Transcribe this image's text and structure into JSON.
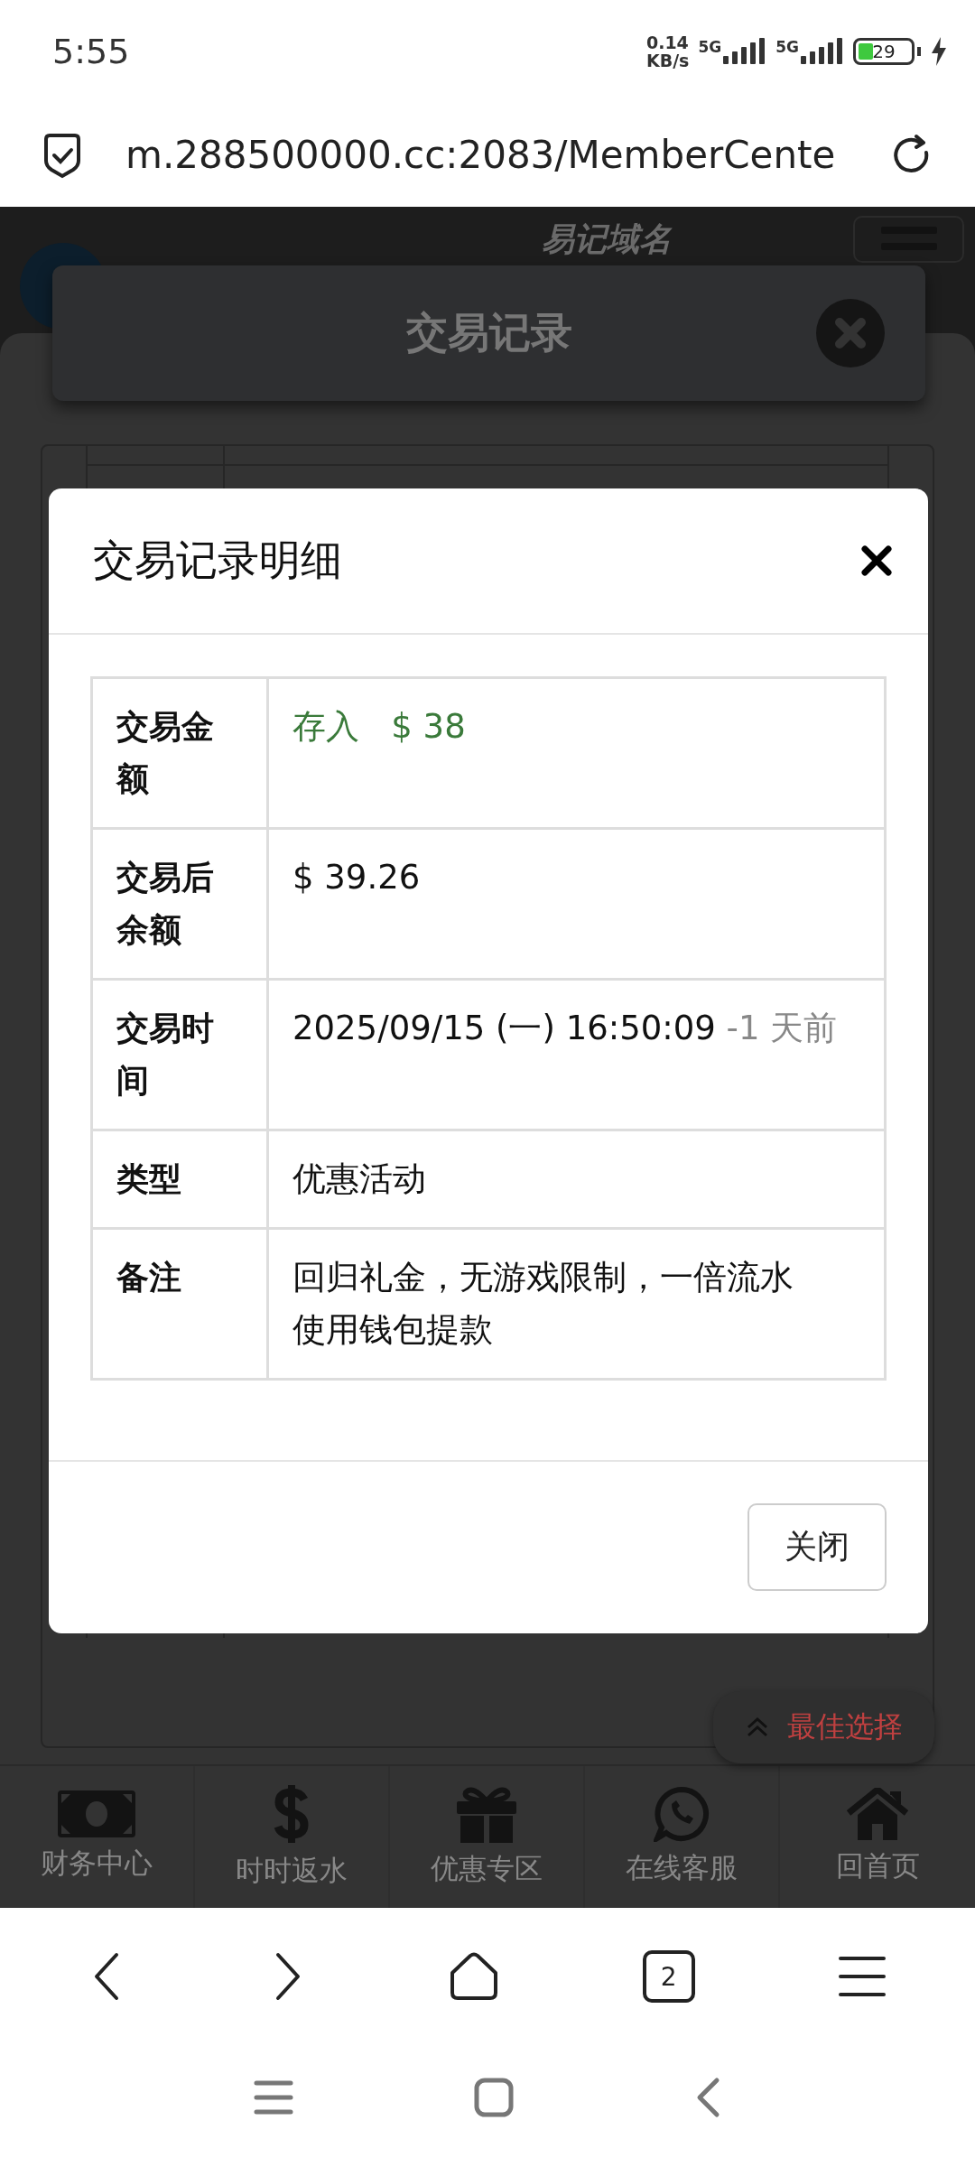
{
  "status_bar": {
    "time": "5:55",
    "net_speed_value": "0.14",
    "net_speed_unit": "KB/s",
    "sim_labels": [
      "5G",
      "5G"
    ],
    "battery": "29"
  },
  "address_bar": {
    "url": "m.288500000.cc:2083/MemberCente"
  },
  "page": {
    "site_name": "易记域名",
    "panel_title": "交易记录",
    "float_button": "最佳选择",
    "bottom_nav": [
      {
        "kind": "money",
        "label": "财务中心"
      },
      {
        "kind": "dollar",
        "label": "时时返水"
      },
      {
        "kind": "gift",
        "label": "优惠专区"
      },
      {
        "kind": "chat",
        "label": "在线客服"
      },
      {
        "kind": "home",
        "label": "回首页"
      }
    ]
  },
  "modal": {
    "title": "交易记录明细",
    "rows": [
      {
        "kind": "amount",
        "label": "交易金额",
        "type": "存入",
        "value": "$ 38"
      },
      {
        "kind": "text",
        "label": "交易后余额",
        "value": "$ 39.26"
      },
      {
        "kind": "time",
        "label": "交易时间",
        "value": "2025/09/15 (一) 16:50:09",
        "relative": "-1 天前"
      },
      {
        "kind": "text",
        "label": "类型",
        "value": "优惠活动"
      },
      {
        "kind": "text",
        "label": "备注",
        "value": "回归礼金，无游戏限制，一倍流水使用钱包提款"
      }
    ],
    "close_button": "关闭"
  },
  "browser_nav": {
    "tab_count": "2"
  }
}
